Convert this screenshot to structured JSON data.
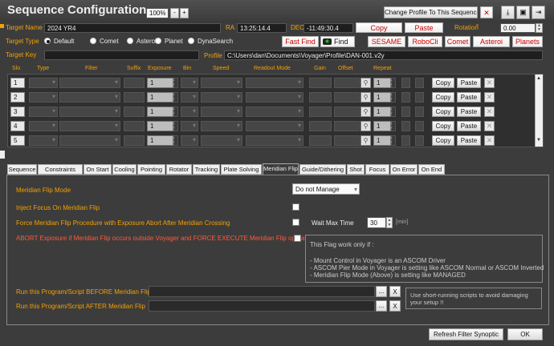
{
  "window": {
    "title": "Sequence Configuration",
    "zoom": "100%",
    "zoom_minus": "-",
    "zoom_plus": "+",
    "change_profile_label": "Change Profile To This Sequence",
    "close_x": "✕"
  },
  "target": {
    "name_label": "Target Name",
    "name_value": "2024 YR4",
    "ra_label": "RA",
    "ra_value": "13:25:14.4",
    "dec_label": "DEC",
    "dec_value": "-11:49:30.4",
    "copy_label": "Copy",
    "paste_label": "Paste",
    "rotation_label": "Rotation",
    "rotation_unit": "°",
    "rotation_value": "0.00",
    "type_label": "Target Type",
    "types": [
      "Default",
      "Comet",
      "Asteroid",
      "Planet",
      "DynaSearch"
    ],
    "selected_type": "Default",
    "fast_find": "Fast Find",
    "find": "Find",
    "services": [
      "SESAME",
      "RoboCli",
      "Comet",
      "Asteroi",
      "Planets"
    ],
    "key_label": "Target Key",
    "key_value": "",
    "profile_label": "Profile",
    "profile_value": "C:\\Users\\dan\\Documents\\Voyager\\Profile\\DAN-001.v2y"
  },
  "grid": {
    "headers": [
      "Slo",
      "Type",
      "Filter",
      "Suffix",
      "Exposure",
      "Bin",
      "Speed",
      "Readout Mode",
      "Gain",
      "Offset",
      "Repeat"
    ],
    "rows": [
      {
        "slot": "1",
        "exposure": "1",
        "repeat": "1"
      },
      {
        "slot": "2",
        "exposure": "1",
        "repeat": "1"
      },
      {
        "slot": "3",
        "exposure": "1",
        "repeat": "1"
      },
      {
        "slot": "4",
        "exposure": "1",
        "repeat": "1"
      },
      {
        "slot": "5",
        "exposure": "1",
        "repeat": "1"
      }
    ],
    "copy_label": "Copy",
    "paste_label": "Paste"
  },
  "tabs": [
    "Sequence",
    "Constraints",
    "On Start",
    "Cooling",
    "Pointing",
    "Rotator",
    "Tracking",
    "Plate Solving",
    "Meridian Flip",
    "Guide/Dithering",
    "Shot",
    "Focus",
    "On Error",
    "On End"
  ],
  "active_tab": "Meridian Flip",
  "meridian": {
    "mode_label": "Meridian Flip Mode",
    "mode_value": "Do not Manage",
    "inject_focus": "Inject Focus On Meridian Flip",
    "force_flip": "Force Meridian Flip Procedure with Exposure Abort After Meridian Crossing",
    "wait_max_label": "Wait Max Time",
    "wait_max_value": "30",
    "wait_unit": "[min]",
    "abort_label": "ABORT Exposure if Meridian Flip occurs outside Voyager and FORCE EXECUTE Meridian Flip operations",
    "note_title": "This Flag work only if :",
    "note_lines": [
      "- Mount Control in Voyager is an ASCOM Driver",
      "- ASCOM Pier Mode in Voyager is setting like ASCOM Normal or ASCOM Inverted",
      "- Meridian Flip Mode (Above) is setting like MANAGED"
    ],
    "before_label": "Run this Program/Script BEFORE Meridian Flip",
    "after_label": "Run this Program/Script AFTER Meridian Flip",
    "browse": "...",
    "clear": "X",
    "tip": "Use short-running scripts to avoid damaging your setup !!"
  },
  "footer": {
    "refresh": "Refresh Filter Synoptic",
    "ok": "OK"
  },
  "colors": {
    "accent": "#f5a000",
    "danger": "#c00000"
  }
}
